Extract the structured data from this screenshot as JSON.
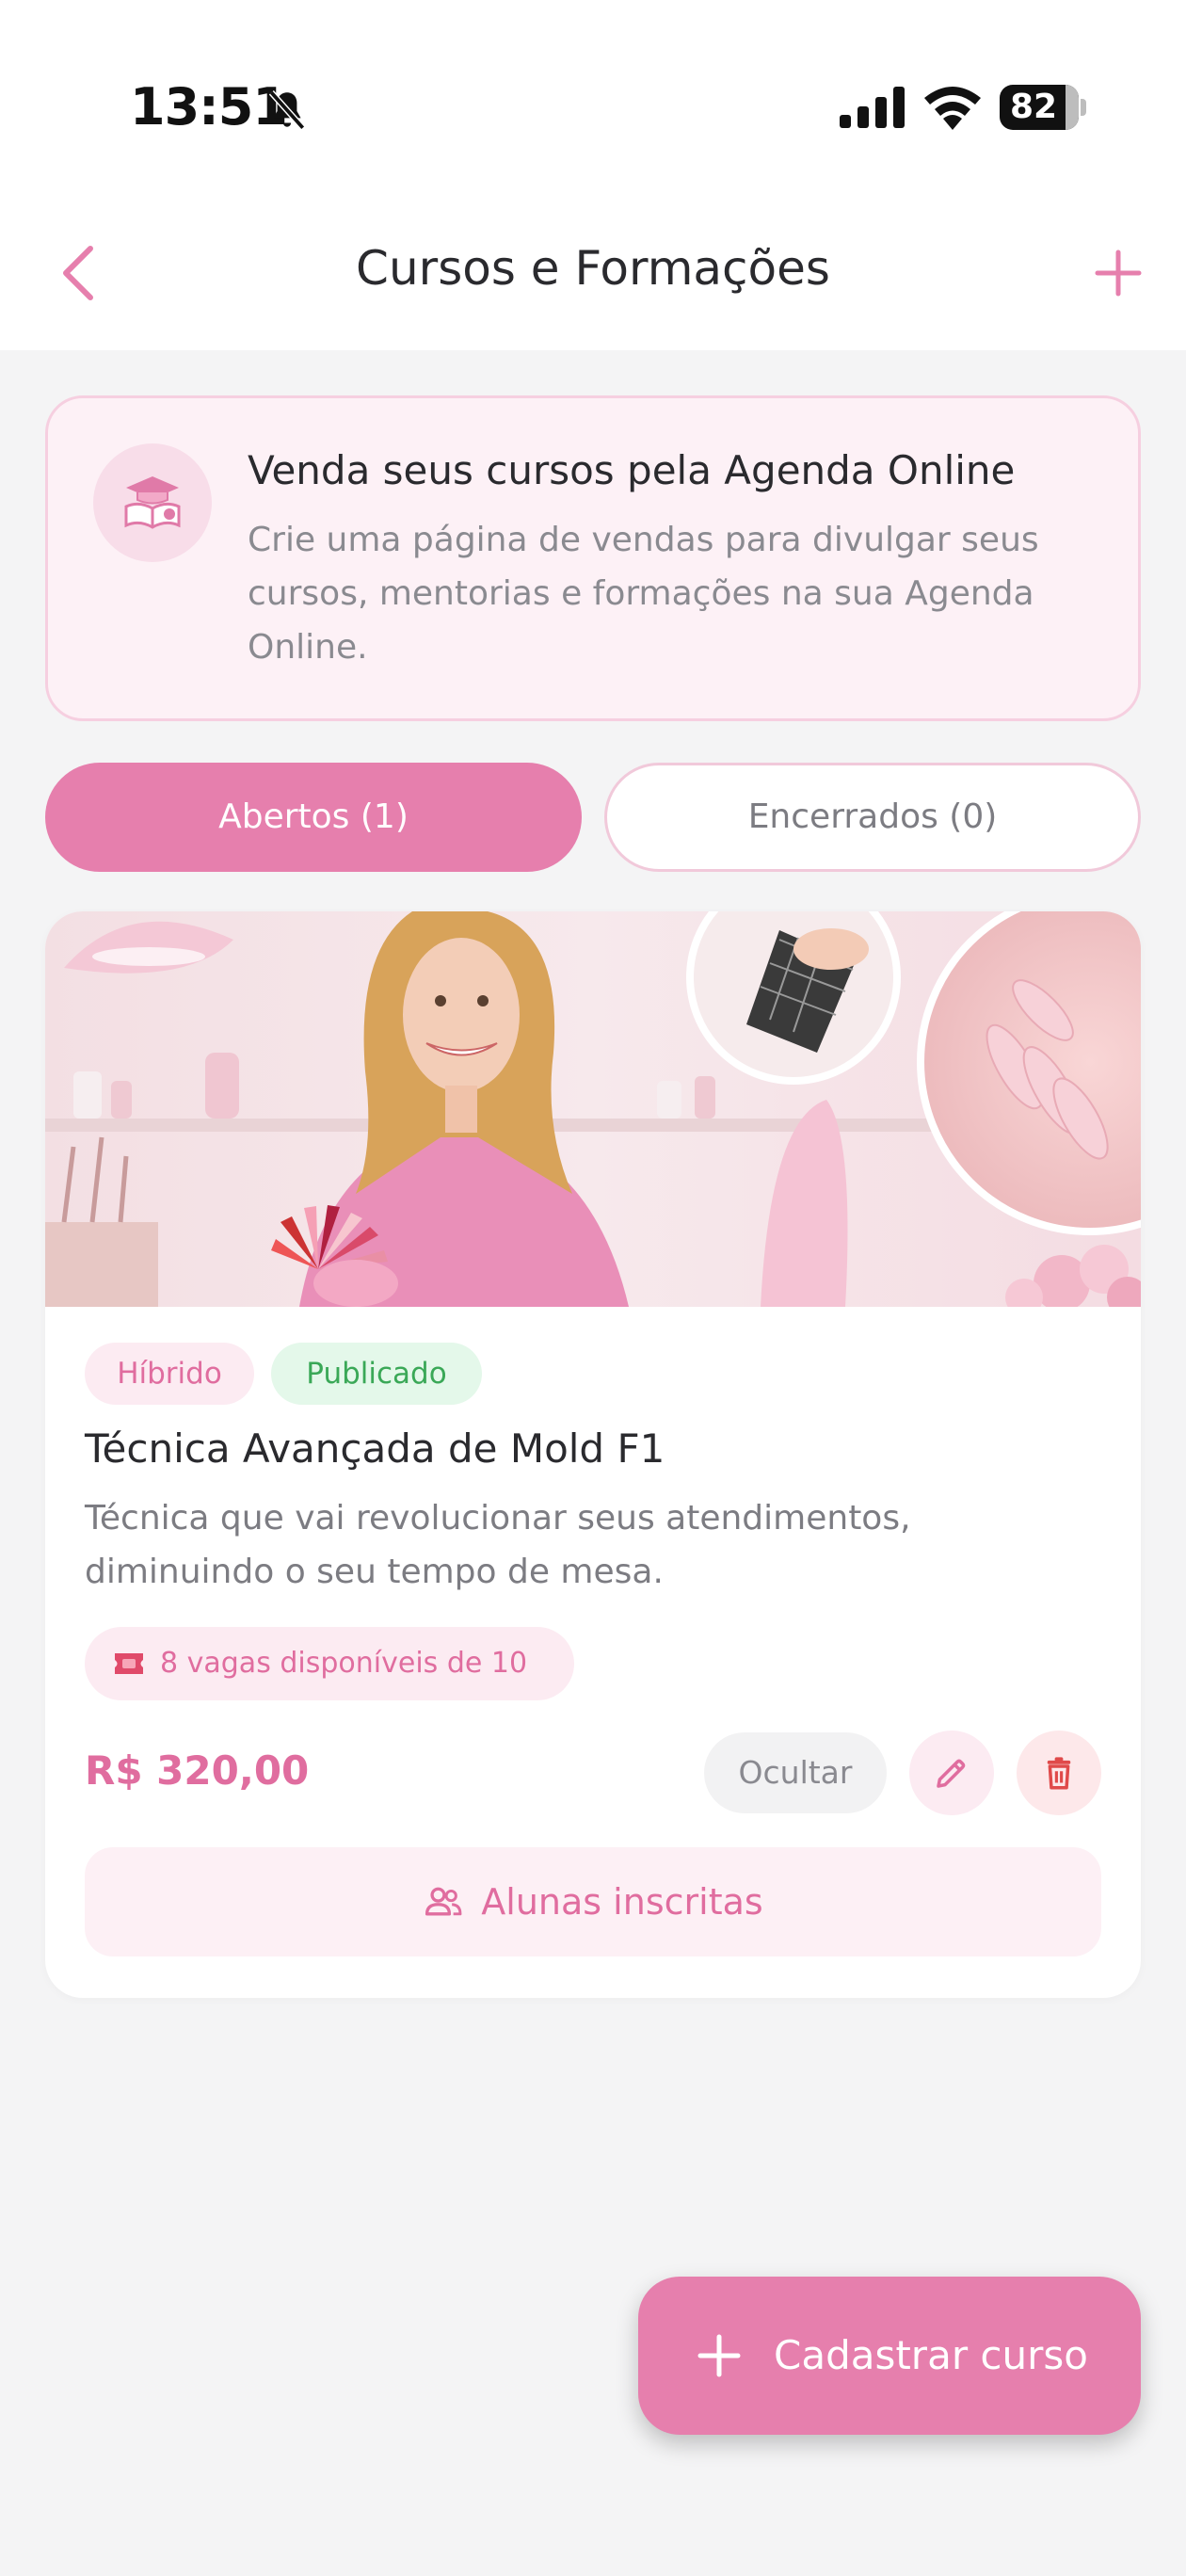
{
  "status_bar": {
    "time": "13:51",
    "battery": "82"
  },
  "header": {
    "title": "Cursos e Formações"
  },
  "promo": {
    "title": "Venda seus cursos pela Agenda Online",
    "text": "Crie uma página de vendas para divulgar seus cursos, mentorias e formações na sua Agenda Online."
  },
  "tabs": [
    {
      "label": "Abertos (1)",
      "active": true
    },
    {
      "label": "Encerrados (0)",
      "active": false
    }
  ],
  "course": {
    "tags": [
      "Híbrido",
      "Publicado"
    ],
    "title": "Técnica Avançada de Mold F1",
    "description": "Técnica que vai revolucionar seus atendimentos, diminuindo o seu tempo de mesa.",
    "seats": "8 vagas disponíveis de 10",
    "price": "R$ 320,00",
    "hide_label": "Ocultar",
    "students_label": "Alunas inscritas"
  },
  "fab": {
    "label": "Cadastrar curso"
  },
  "colors": {
    "accent": "#e67fad",
    "accent_text": "#e06d9f",
    "success": "#3aa857",
    "danger": "#e04a4a"
  }
}
